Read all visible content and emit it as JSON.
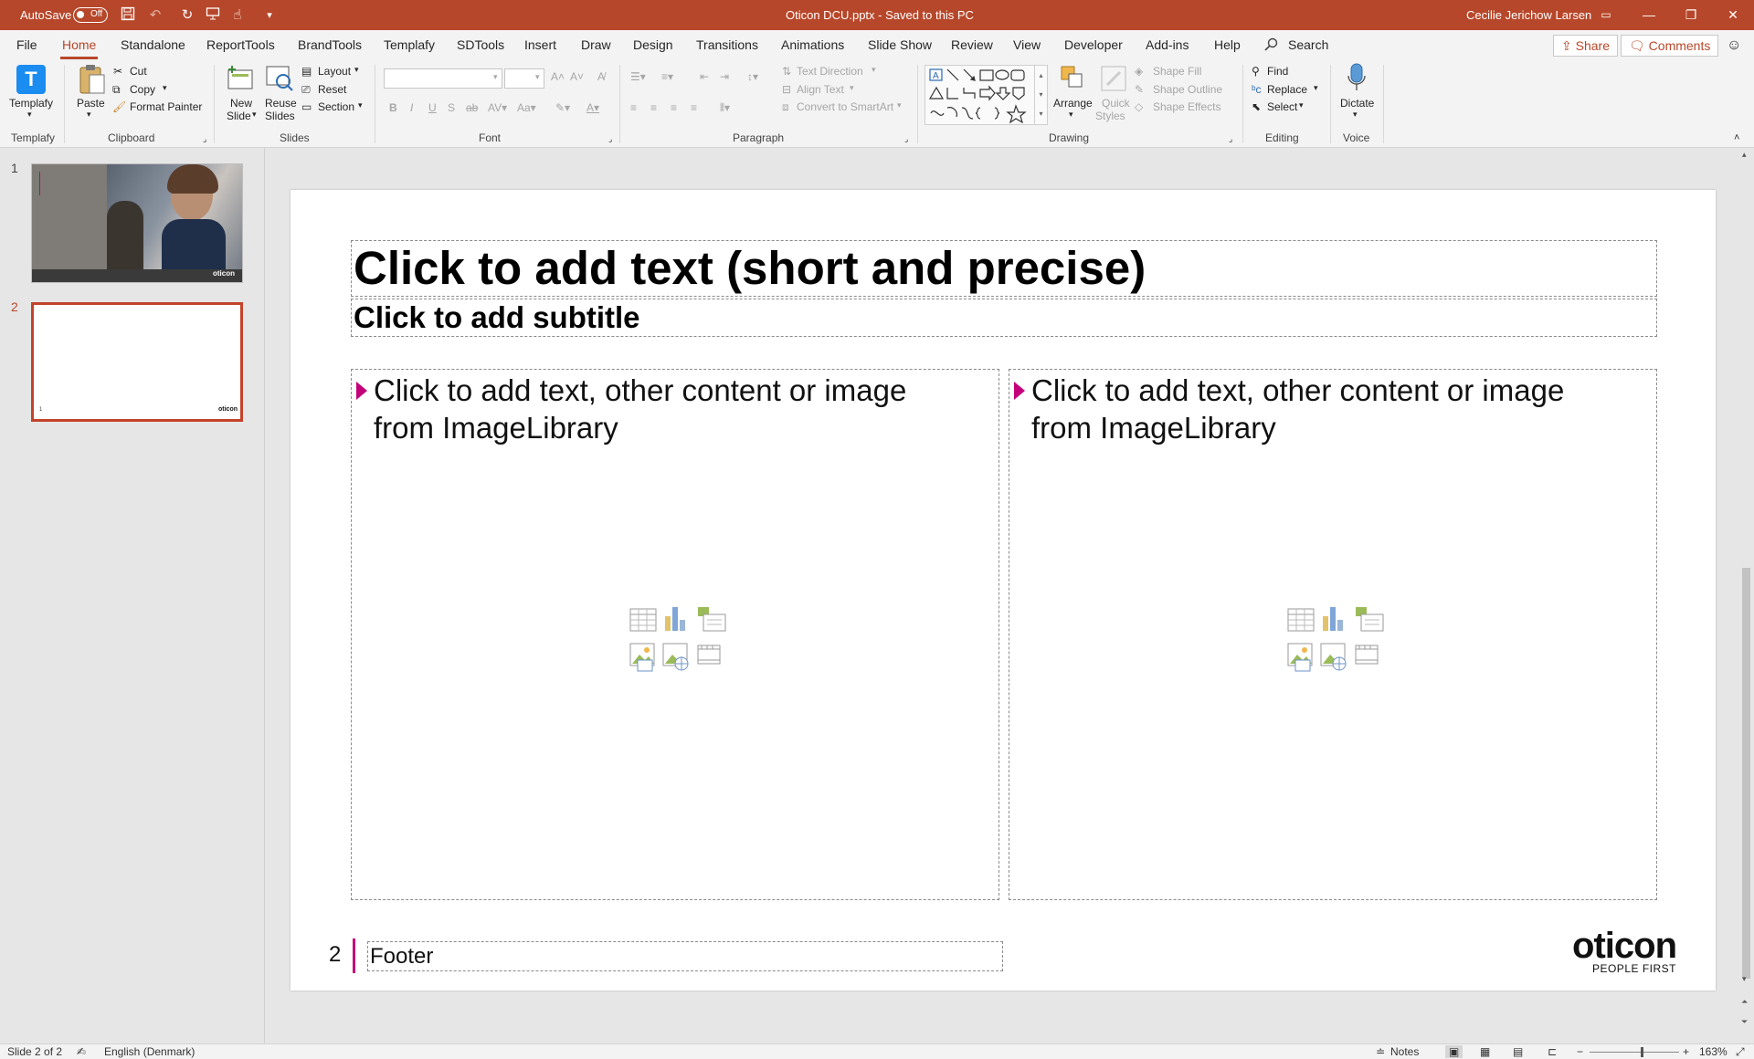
{
  "titlebar": {
    "autosave_label": "AutoSave",
    "autosave_state": "Off",
    "document_title": "Oticon DCU.pptx  -  Saved to this PC",
    "user_name": "Cecilie Jerichow Larsen",
    "minimize": "—",
    "restore": "❐",
    "close": "✕"
  },
  "menu_tabs": [
    "File",
    "Home",
    "Standalone",
    "ReportTools",
    "BrandTools",
    "Templafy",
    "SDTools",
    "Insert",
    "Draw",
    "Design",
    "Transitions",
    "Animations",
    "Slide Show",
    "Review",
    "View",
    "Developer",
    "Add-ins",
    "Help"
  ],
  "search_label": "Search",
  "share_label": "Share",
  "comments_label": "Comments",
  "ribbon": {
    "templafy": {
      "button": "Templafy",
      "group": "Templafy"
    },
    "clipboard": {
      "paste": "Paste",
      "cut": "Cut",
      "copy": "Copy",
      "format_painter": "Format Painter",
      "group": "Clipboard"
    },
    "slides": {
      "new_slide_1": "New",
      "new_slide_2": "Slide",
      "reuse_1": "Reuse",
      "reuse_2": "Slides",
      "layout": "Layout",
      "reset": "Reset",
      "section": "Section",
      "group": "Slides"
    },
    "font": {
      "bold": "B",
      "italic": "I",
      "underline": "U",
      "shadow": "S",
      "strike": "ab",
      "group": "Font"
    },
    "paragraph": {
      "text_direction": "Text Direction",
      "align_text": "Align Text",
      "convert_smartart": "Convert to SmartArt",
      "group": "Paragraph"
    },
    "drawing": {
      "arrange": "Arrange",
      "quick_styles_1": "Quick",
      "quick_styles_2": "Styles",
      "shape_fill": "Shape Fill",
      "shape_outline": "Shape Outline",
      "shape_effects": "Shape Effects",
      "group": "Drawing"
    },
    "editing": {
      "find": "Find",
      "replace": "Replace",
      "select": "Select",
      "group": "Editing"
    },
    "voice": {
      "dictate": "Dictate",
      "group": "Voice"
    }
  },
  "thumbnails": [
    {
      "number": "1",
      "logo": "oticon"
    },
    {
      "number": "2",
      "logo": "oticon",
      "page": "1"
    }
  ],
  "slide": {
    "title": "Click to add text (short and precise)",
    "subtitle": "Click to add subtitle",
    "left_body": "Click to add text, other content or image from ImageLibrary",
    "right_body": "Click to add text, other content or image from ImageLibrary",
    "page_number": "2",
    "footer": "Footer",
    "logo_text": "oticon",
    "logo_tagline": "PEOPLE FIRST",
    "accent_color": "#c3007a"
  },
  "statusbar": {
    "slide_info": "Slide 2 of 2",
    "language": "English (Denmark)",
    "notes": "Notes",
    "zoom_minus": "−",
    "zoom_plus": "+",
    "zoom": "163%"
  },
  "colors": {
    "brand": "#b7472a",
    "accent": "#c3007a"
  }
}
